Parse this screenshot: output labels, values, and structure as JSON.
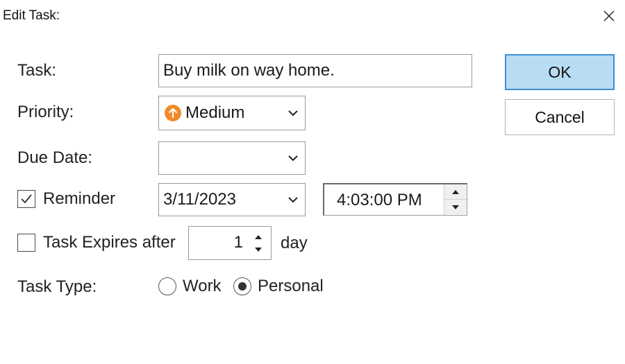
{
  "window": {
    "title": "Edit Task:"
  },
  "form": {
    "task_label": "Task:",
    "task_value": "Buy milk on way home.",
    "priority_label": "Priority:",
    "priority_value": "Medium",
    "priority_icon": "up-arrow-icon",
    "priority_color": "#f08a2a",
    "due_date_label": "Due Date:",
    "due_date_value": "",
    "reminder_label": "Reminder",
    "reminder_checked": true,
    "reminder_date": "3/11/2023",
    "reminder_time": "4:03:00 PM",
    "expires_label": "Task Expires after",
    "expires_checked": false,
    "expires_value": "1",
    "expires_unit": "day",
    "task_type_label": "Task Type:",
    "task_type_options": [
      "Work",
      "Personal"
    ],
    "task_type_selected": "Personal"
  },
  "buttons": {
    "ok": "OK",
    "cancel": "Cancel"
  },
  "colors": {
    "ok_background": "#b9dcf5",
    "ok_border": "#3d8fd1"
  }
}
